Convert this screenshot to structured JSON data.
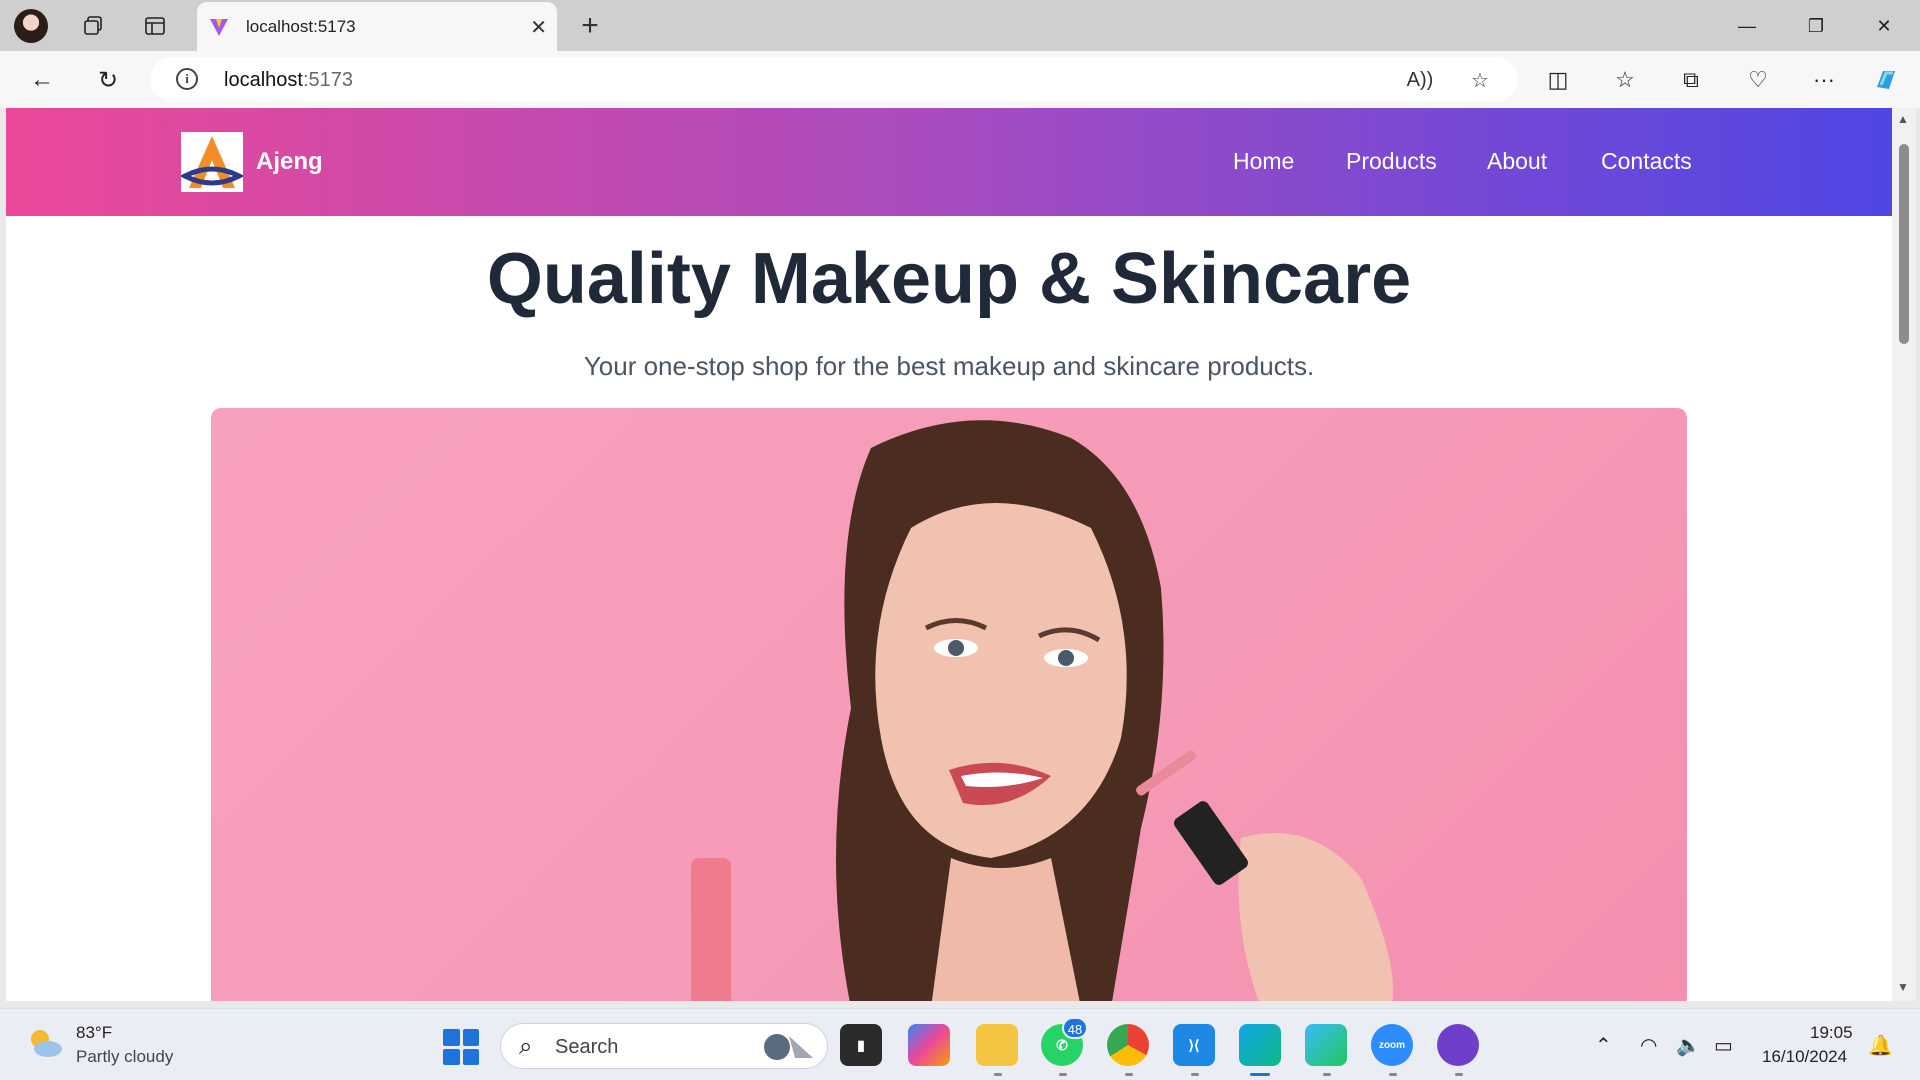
{
  "browser": {
    "tab_title": "localhost:5173",
    "url_host": "localhost",
    "url_port": ":5173",
    "icons": [
      "profile-avatar",
      "workspaces-icon",
      "tab-actions-icon",
      "vite-favicon",
      "close-icon",
      "new-tab-icon",
      "minimize-icon",
      "restore-icon",
      "window-close-icon",
      "back-icon",
      "refresh-icon",
      "site-info-icon",
      "read-aloud-icon",
      "favorite-star-icon",
      "split-screen-icon",
      "favorites-icon",
      "collections-icon",
      "browser-essentials-icon",
      "more-icon",
      "copilot-icon"
    ]
  },
  "page": {
    "brand": "Ajeng",
    "nav": [
      "Home",
      "Products",
      "About",
      "Contacts"
    ],
    "hero_title": "Quality Makeup & Skincare",
    "hero_subtitle": "Your one-stop shop for the best makeup and skincare products."
  },
  "taskbar": {
    "weather_temp": "83°F",
    "weather_desc": "Partly cloudy",
    "search_label": "Search",
    "whatsapp_badge": "48",
    "zoom_label": "zoom",
    "time": "19:05",
    "date": "16/10/2024"
  },
  "colors": {
    "nav_gradient_start": "#ec4899",
    "nav_gradient_end": "#4f46e5",
    "title_text": "#1f2937",
    "hero_bg": "#f8a1bd"
  }
}
